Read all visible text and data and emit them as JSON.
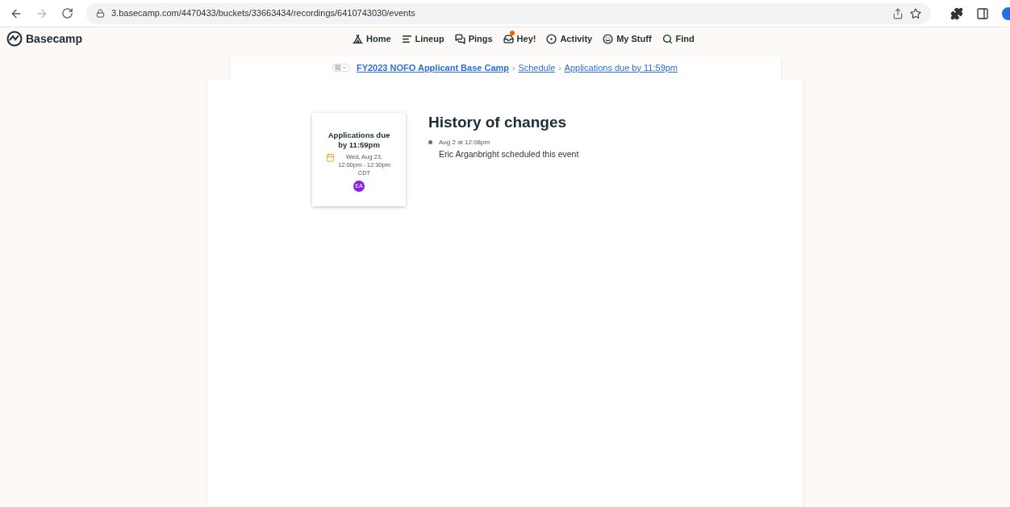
{
  "browser": {
    "url": "3.basecamp.com/4470433/buckets/33663434/recordings/6410743030/events"
  },
  "app": {
    "logo": "Basecamp"
  },
  "nav": [
    {
      "label": "Home",
      "badge": false
    },
    {
      "label": "Lineup",
      "badge": false
    },
    {
      "label": "Pings",
      "badge": false
    },
    {
      "label": "Hey!",
      "badge": true
    },
    {
      "label": "Activity",
      "badge": false
    },
    {
      "label": "My Stuff",
      "badge": false
    },
    {
      "label": "Find",
      "badge": false
    }
  ],
  "breadcrumb": [
    {
      "label": "FY2023 NOFO Applicant Base Camp",
      "bold": true
    },
    {
      "label": "Schedule",
      "bold": false,
      "separator": "›"
    },
    {
      "label": "Applications due by 11:59pm",
      "bold": false,
      "separator": "›"
    }
  ],
  "event_card": {
    "title": "Applications due by 11:59pm",
    "date": "Wed, Aug 23, 12:00pm - 12:30pm CDT",
    "avatar": "EA"
  },
  "history": {
    "title": "History of changes",
    "entries": [
      {
        "time": "Aug 2 at 12:08pm",
        "text": "Eric Arganbright scheduled this event"
      }
    ]
  }
}
